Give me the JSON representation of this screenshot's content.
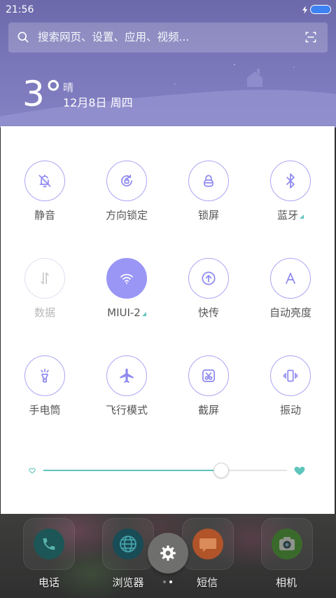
{
  "status_bar": {
    "time": "21:56",
    "charging_icon": "bolt-icon",
    "battery_icon": "battery-icon",
    "battery_level": 1.0
  },
  "search": {
    "placeholder": "搜索网页、设置、应用、视频...",
    "left_icon": "search-icon",
    "right_icon": "scan-icon"
  },
  "weather": {
    "temperature": "3°",
    "condition": "晴",
    "date": "12月8日 周四"
  },
  "toggles": [
    {
      "label": "静音",
      "icon": "bell-off-icon",
      "active": false,
      "disabled": false
    },
    {
      "label": "方向锁定",
      "icon": "rotation-lock-icon",
      "active": false,
      "disabled": false
    },
    {
      "label": "锁屏",
      "icon": "lock-icon",
      "active": false,
      "disabled": false
    },
    {
      "label": "蓝牙",
      "icon": "bluetooth-icon",
      "active": false,
      "disabled": false,
      "expandable": true
    },
    {
      "label": "数据",
      "icon": "mobile-data-icon",
      "active": false,
      "disabled": true
    },
    {
      "label": "MIUI-2",
      "icon": "wifi-icon",
      "active": true,
      "disabled": false,
      "expandable": true
    },
    {
      "label": "快传",
      "icon": "quick-transfer-icon",
      "active": false,
      "disabled": false
    },
    {
      "label": "自动亮度",
      "icon": "auto-brightness-icon",
      "active": false,
      "disabled": false
    },
    {
      "label": "手电筒",
      "icon": "flashlight-icon",
      "active": false,
      "disabled": false
    },
    {
      "label": "飞行模式",
      "icon": "airplane-icon",
      "active": false,
      "disabled": false
    },
    {
      "label": "截屏",
      "icon": "screenshot-icon",
      "active": false,
      "disabled": false
    },
    {
      "label": "振动",
      "icon": "vibrate-icon",
      "active": false,
      "disabled": false
    }
  ],
  "brightness": {
    "level": 0.73,
    "min_icon": "heart-outline-icon",
    "max_icon": "heart-filled-icon"
  },
  "dock": [
    {
      "label": "电话",
      "icon": "phone-icon"
    },
    {
      "label": "浏览器",
      "icon": "browser-icon"
    },
    {
      "label": "短信",
      "icon": "messages-icon"
    },
    {
      "label": "相机",
      "icon": "camera-icon"
    }
  ],
  "settings_button": {
    "icon": "gear-icon"
  },
  "page_indicator": {
    "count": 2,
    "current": 2
  },
  "colors": {
    "shade_top": "#6b69aa",
    "toggle_stroke": "#aaa6f3",
    "toggle_active": "#9a96f6",
    "icon_stroke": "#8f8af0",
    "slider_fill": "#5ec4bc",
    "label_text": "#555555"
  }
}
